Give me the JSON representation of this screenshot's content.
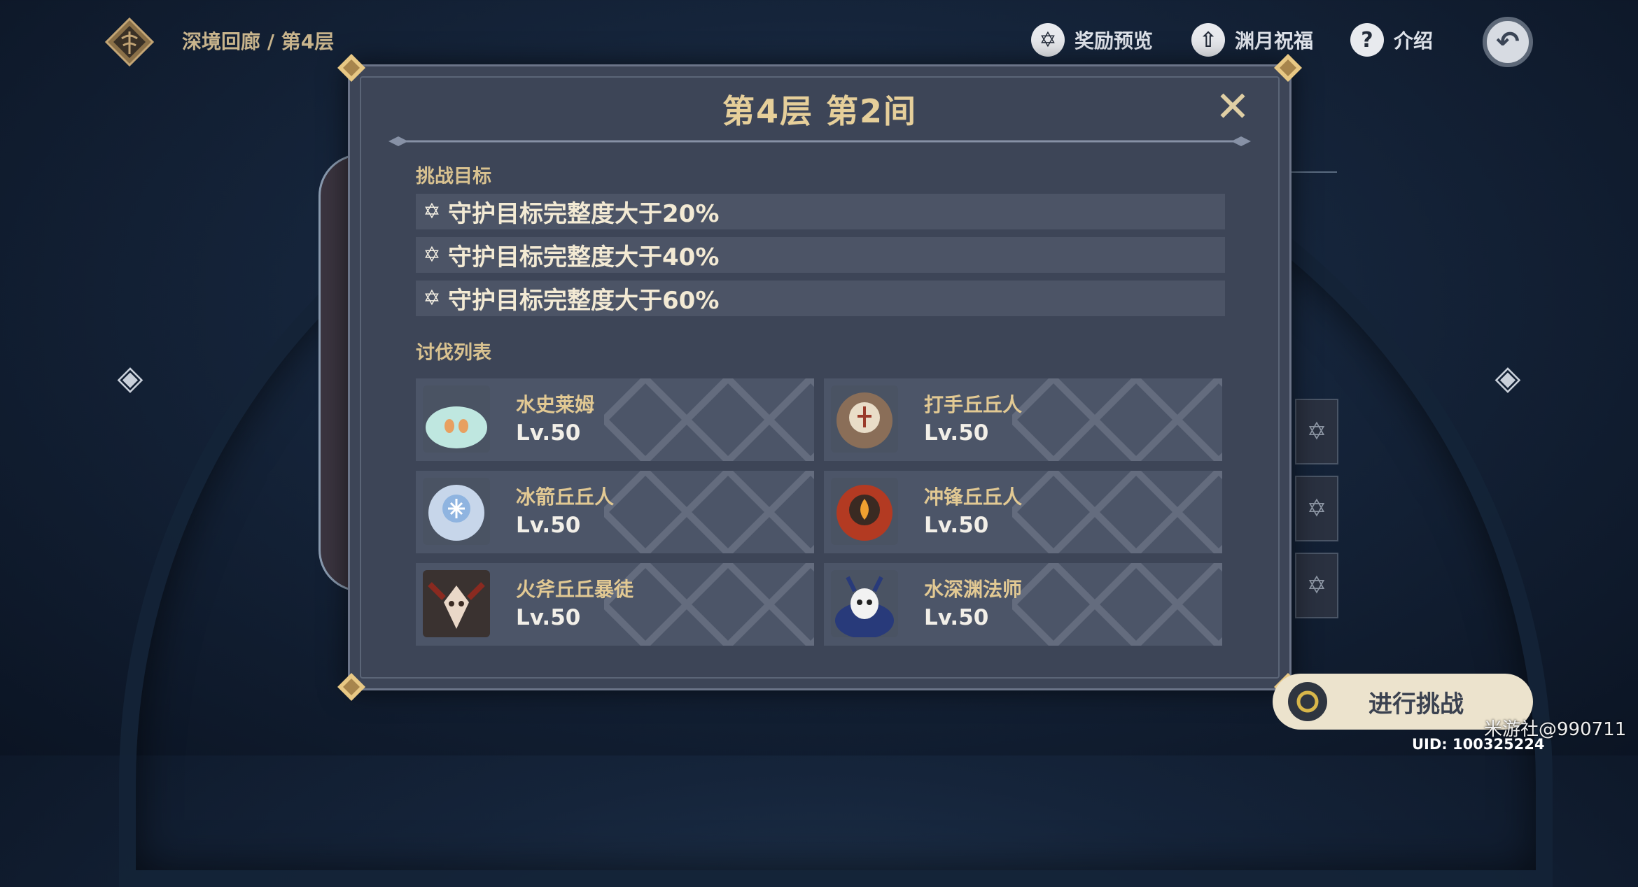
{
  "topbar": {
    "breadcrumb": "深境回廊 / 第4层",
    "actions": [
      {
        "label": "奖励预览",
        "icon": "star-icon"
      },
      {
        "label": "渊月祝福",
        "icon": "upload-icon"
      },
      {
        "label": "介绍",
        "icon": "help-icon"
      }
    ]
  },
  "modal": {
    "title": "第4层 第2间",
    "objectives_label": "挑战目标",
    "objectives": [
      "守护目标完整度大于20%",
      "守护目标完整度大于40%",
      "守护目标完整度大于60%"
    ],
    "enemies_label": "讨伐列表",
    "enemies": [
      {
        "name": "水史莱姆",
        "level": "Lv.50",
        "icon": "hydro-slime-icon"
      },
      {
        "name": "打手丘丘人",
        "level": "Lv.50",
        "icon": "hilichurl-fighter-icon"
      },
      {
        "name": "冰箭丘丘人",
        "level": "Lv.50",
        "icon": "cryo-hilichurl-shooter-icon"
      },
      {
        "name": "冲锋丘丘人",
        "level": "Lv.50",
        "icon": "hilichurl-berserker-icon"
      },
      {
        "name": "火斧丘丘暴徒",
        "level": "Lv.50",
        "icon": "pyro-mitachurl-icon"
      },
      {
        "name": "水深渊法师",
        "level": "Lv.50",
        "icon": "hydro-abyss-mage-icon"
      }
    ]
  },
  "start_button": {
    "label": "进行挑战"
  },
  "watermark": "米游社@990711",
  "uid": "UID: 100325224",
  "colors": {
    "gold": "#e6cf9a",
    "panel": "#3d4557",
    "row": "#4c5466"
  }
}
